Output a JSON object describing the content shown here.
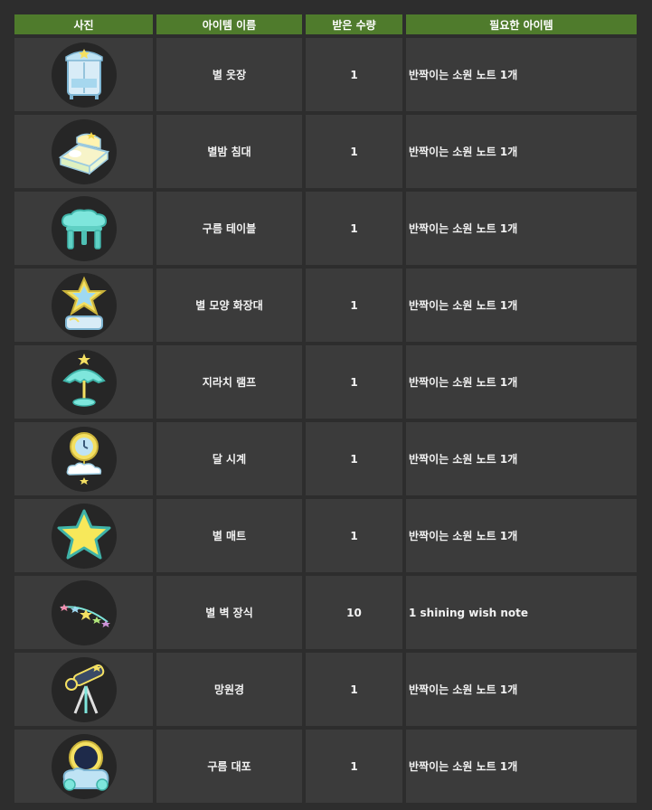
{
  "table": {
    "headers": [
      "사진",
      "아이템 이름",
      "받은 수량",
      "필요한 아이템"
    ],
    "rows": [
      {
        "icon": "star-wardrobe-icon",
        "name": "별 옷장",
        "qty": "1",
        "requirement": "반짝이는 소원 노트 1개"
      },
      {
        "icon": "starry-night-bed-icon",
        "name": "별밤 침대",
        "qty": "1",
        "requirement": "반짝이는 소원 노트 1개"
      },
      {
        "icon": "cloud-table-icon",
        "name": "구름 테이블",
        "qty": "1",
        "requirement": "반짝이는 소원 노트 1개"
      },
      {
        "icon": "star-vanity-icon",
        "name": "별 모양 화장대",
        "qty": "1",
        "requirement": "반짝이는 소원 노트 1개"
      },
      {
        "icon": "jellyfish-lamp-icon",
        "name": "지라치 램프",
        "qty": "1",
        "requirement": "반짝이는 소원 노트 1개"
      },
      {
        "icon": "moon-clock-icon",
        "name": "달 시계",
        "qty": "1",
        "requirement": "반짝이는 소원 노트 1개"
      },
      {
        "icon": "star-mat-icon",
        "name": "별 매트",
        "qty": "1",
        "requirement": "반짝이는 소원 노트 1개"
      },
      {
        "icon": "star-wall-decoration-icon",
        "name": "별 벽 장식",
        "qty": "10",
        "requirement": "1 shining wish note"
      },
      {
        "icon": "telescope-icon",
        "name": "망원경",
        "qty": "1",
        "requirement": "반짝이는 소원 노트 1개"
      },
      {
        "icon": "cloud-cannon-icon",
        "name": "구름 대포",
        "qty": "1",
        "requirement": "반짝이는 소원 노트 1개"
      }
    ]
  },
  "colors": {
    "header_bg": "#4f7b2c",
    "cell_bg": "#3b3b3b",
    "page_bg": "#2d2d2d"
  }
}
